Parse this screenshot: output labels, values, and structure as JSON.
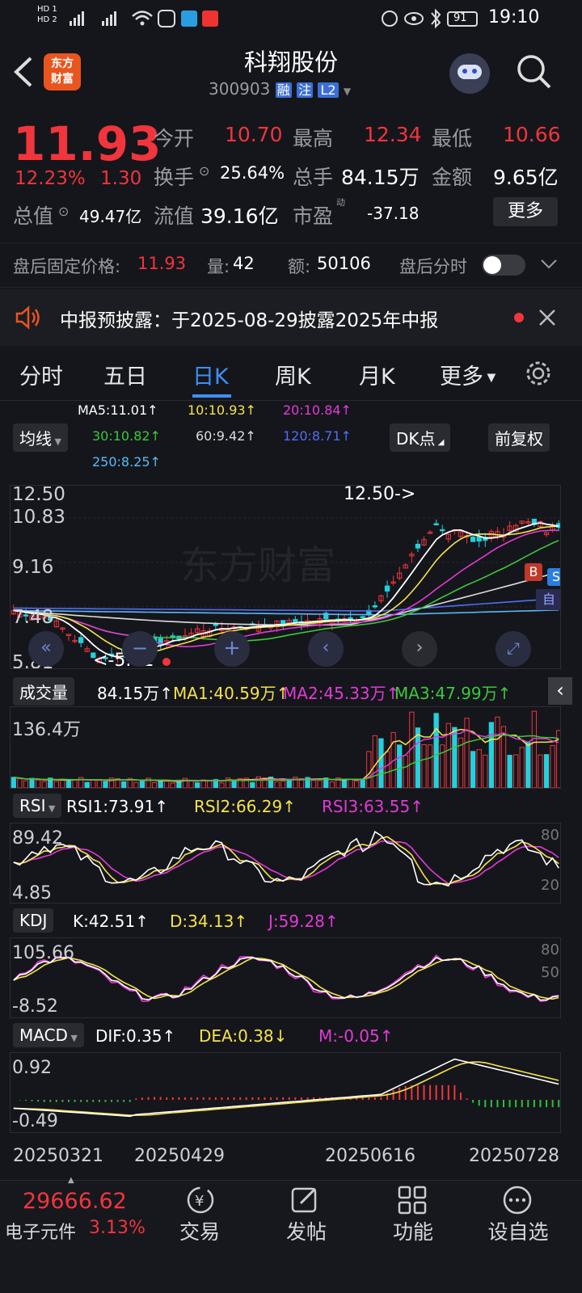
{
  "status": {
    "time": "19:10",
    "battery": "91",
    "hd1": "HD 1",
    "hd2": "HD 2"
  },
  "header": {
    "logo_line1": "东方",
    "logo_line2": "财富",
    "title": "科翔股份",
    "code": "300903",
    "badge_rong": "融",
    "badge_zhu": "注",
    "badge_l2": "L2"
  },
  "quote": {
    "price": "11.93",
    "change_pct": "12.23%",
    "change_amt": "1.30",
    "open_label": "今开",
    "open": "10.70",
    "high_label": "最高",
    "high": "12.34",
    "low_label": "最低",
    "low": "10.66",
    "turnover_label": "换手",
    "turnover": "25.64%",
    "volume_label": "总手",
    "volume": "84.15万",
    "amount_label": "金额",
    "amount": "9.65亿",
    "mcap_label": "总值",
    "mcap": "49.47亿",
    "float_label": "流值",
    "float": "39.16亿",
    "pe_label": "市盈",
    "pe_sup": "动",
    "pe": "-37.18",
    "more": "更多"
  },
  "afterhours": {
    "label": "盘后固定价格:",
    "price": "11.93",
    "vol_label": "量:",
    "vol": "42",
    "amt_label": "额:",
    "amt": "50106",
    "toggle_label": "盘后分时"
  },
  "notice": {
    "text": "中报预披露：于2025-08-29披露2025年中报"
  },
  "tabs": [
    "分时",
    "五日",
    "日K",
    "周K",
    "月K",
    "更多"
  ],
  "ma": {
    "ma5": "MA5:11.01↑",
    "ma10": "10:10.93↑",
    "ma20": "20:10.84↑",
    "ma30": "30:10.82↑",
    "ma60": "60:9.42↑",
    "ma120": "120:8.71↑",
    "ma250": "250:8.25↑",
    "btn_avg": "均线",
    "btn_dk": "DK点",
    "btn_fq": "前复权"
  },
  "kline": {
    "y_top": "12.50",
    "y2": "10.83",
    "y3": "9.16",
    "y4": "7.48",
    "y_bot": "5.81",
    "max_label": "12.50->",
    "min_label": "<-5.81",
    "badge_b": "B",
    "badge_s": "S",
    "badge_zi": "自",
    "watermark": "东方财富"
  },
  "volume": {
    "label": "成交量",
    "vol": "84.15万↑",
    "ma1": "MA1:40.59万↑",
    "ma2": "MA2:45.33万↑",
    "ma3": "MA3:47.99万↑",
    "y_top": "136.4万"
  },
  "rsi": {
    "label": "RSI",
    "rsi1": "RSI1:73.91↑",
    "rsi2": "RSI2:66.29↑",
    "rsi3": "RSI3:63.55↑",
    "y_top": "89.42",
    "y_bot": "4.85",
    "r80": "80",
    "r20": "20"
  },
  "kdj": {
    "label": "KDJ",
    "k": "K:42.51↑",
    "d": "D:34.13↑",
    "j": "J:59.28↑",
    "y_top": "105.66",
    "y_bot": "-8.52",
    "r80": "80",
    "r50": "50"
  },
  "macd": {
    "label": "MACD",
    "dif": "DIF:0.35↑",
    "dea": "DEA:0.38↓",
    "m": "M:-0.05↑",
    "y_top": "0.92",
    "y_bot": "-0.49"
  },
  "dates": [
    "20250321",
    "20250429",
    "20250616",
    "20250728"
  ],
  "bottom": {
    "index_value": "29666.62",
    "index_name": "电子元件",
    "index_pct": "3.13%",
    "nav": [
      "交易",
      "发帖",
      "功能",
      "设自选"
    ]
  }
}
